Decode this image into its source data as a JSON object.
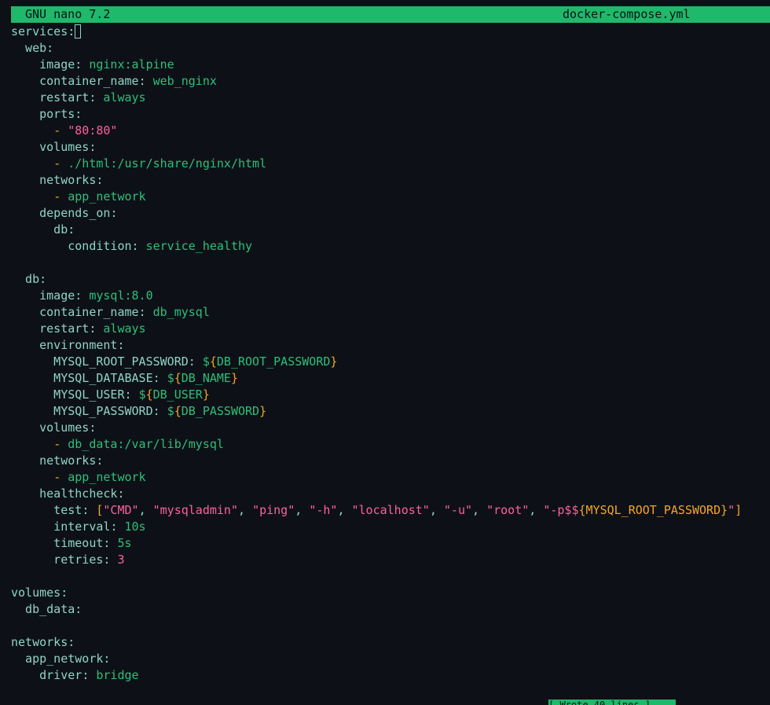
{
  "titlebar": {
    "app_name": "GNU nano 7.2",
    "file_name": "docker-compose.yml"
  },
  "statusbar": {
    "text": "[ Wrote 40 lines ]"
  },
  "colors": {
    "title_bg": "#20b86a",
    "background": "#0d1117",
    "key": "#8fd5c4",
    "value": "#2fbf7a",
    "dash": "#f5a623",
    "string": "#ff5fa2"
  },
  "lines": [
    [
      {
        "t": "k",
        "v": "services"
      },
      {
        "t": "p",
        "v": ":"
      },
      {
        "t": "cursor",
        "v": ""
      }
    ],
    [
      {
        "t": "k",
        "v": "  web"
      },
      {
        "t": "p",
        "v": ":"
      }
    ],
    [
      {
        "t": "k",
        "v": "    image"
      },
      {
        "t": "p",
        "v": ": "
      },
      {
        "t": "v",
        "v": "nginx:alpine"
      }
    ],
    [
      {
        "t": "k",
        "v": "    container_name"
      },
      {
        "t": "p",
        "v": ": "
      },
      {
        "t": "v",
        "v": "web_nginx"
      }
    ],
    [
      {
        "t": "k",
        "v": "    restart"
      },
      {
        "t": "p",
        "v": ": "
      },
      {
        "t": "v",
        "v": "always"
      }
    ],
    [
      {
        "t": "k",
        "v": "    ports"
      },
      {
        "t": "p",
        "v": ":"
      }
    ],
    [
      {
        "t": "k",
        "v": "      "
      },
      {
        "t": "d",
        "v": "- "
      },
      {
        "t": "s",
        "v": "\"80:80\""
      }
    ],
    [
      {
        "t": "k",
        "v": "    volumes"
      },
      {
        "t": "p",
        "v": ":"
      }
    ],
    [
      {
        "t": "k",
        "v": "      "
      },
      {
        "t": "d",
        "v": "- "
      },
      {
        "t": "v",
        "v": "./html:/usr/share/nginx/html"
      }
    ],
    [
      {
        "t": "k",
        "v": "    networks"
      },
      {
        "t": "p",
        "v": ":"
      }
    ],
    [
      {
        "t": "k",
        "v": "      "
      },
      {
        "t": "d",
        "v": "- "
      },
      {
        "t": "v",
        "v": "app_network"
      }
    ],
    [
      {
        "t": "k",
        "v": "    depends_on"
      },
      {
        "t": "p",
        "v": ":"
      }
    ],
    [
      {
        "t": "k",
        "v": "      db"
      },
      {
        "t": "p",
        "v": ":"
      }
    ],
    [
      {
        "t": "k",
        "v": "        condition"
      },
      {
        "t": "p",
        "v": ": "
      },
      {
        "t": "v",
        "v": "service_healthy"
      }
    ],
    [],
    [
      {
        "t": "k",
        "v": "  db"
      },
      {
        "t": "p",
        "v": ":"
      }
    ],
    [
      {
        "t": "k",
        "v": "    image"
      },
      {
        "t": "p",
        "v": ": "
      },
      {
        "t": "v",
        "v": "mysql:8.0"
      }
    ],
    [
      {
        "t": "k",
        "v": "    container_name"
      },
      {
        "t": "p",
        "v": ": "
      },
      {
        "t": "v",
        "v": "db_mysql"
      }
    ],
    [
      {
        "t": "k",
        "v": "    restart"
      },
      {
        "t": "p",
        "v": ": "
      },
      {
        "t": "v",
        "v": "always"
      }
    ],
    [
      {
        "t": "k",
        "v": "    environment"
      },
      {
        "t": "p",
        "v": ":"
      }
    ],
    [
      {
        "t": "k",
        "v": "      MYSQL_ROOT_PASSWORD"
      },
      {
        "t": "p",
        "v": ": "
      },
      {
        "t": "v",
        "v": "$"
      },
      {
        "t": "b",
        "v": "{"
      },
      {
        "t": "v",
        "v": "DB_ROOT_PASSWORD"
      },
      {
        "t": "b",
        "v": "}"
      }
    ],
    [
      {
        "t": "k",
        "v": "      MYSQL_DATABASE"
      },
      {
        "t": "p",
        "v": ": "
      },
      {
        "t": "v",
        "v": "$"
      },
      {
        "t": "b",
        "v": "{"
      },
      {
        "t": "v",
        "v": "DB_NAME"
      },
      {
        "t": "b",
        "v": "}"
      }
    ],
    [
      {
        "t": "k",
        "v": "      MYSQL_USER"
      },
      {
        "t": "p",
        "v": ": "
      },
      {
        "t": "v",
        "v": "$"
      },
      {
        "t": "b",
        "v": "{"
      },
      {
        "t": "v",
        "v": "DB_USER"
      },
      {
        "t": "b",
        "v": "}"
      }
    ],
    [
      {
        "t": "k",
        "v": "      MYSQL_PASSWORD"
      },
      {
        "t": "p",
        "v": ": "
      },
      {
        "t": "v",
        "v": "$"
      },
      {
        "t": "b",
        "v": "{"
      },
      {
        "t": "v",
        "v": "DB_PASSWORD"
      },
      {
        "t": "b",
        "v": "}"
      }
    ],
    [
      {
        "t": "k",
        "v": "    volumes"
      },
      {
        "t": "p",
        "v": ":"
      }
    ],
    [
      {
        "t": "k",
        "v": "      "
      },
      {
        "t": "d",
        "v": "- "
      },
      {
        "t": "v",
        "v": "db_data:/var/lib/mysql"
      }
    ],
    [
      {
        "t": "k",
        "v": "    networks"
      },
      {
        "t": "p",
        "v": ":"
      }
    ],
    [
      {
        "t": "k",
        "v": "      "
      },
      {
        "t": "d",
        "v": "- "
      },
      {
        "t": "v",
        "v": "app_network"
      }
    ],
    [
      {
        "t": "k",
        "v": "    healthcheck"
      },
      {
        "t": "p",
        "v": ":"
      }
    ],
    [
      {
        "t": "k",
        "v": "      test"
      },
      {
        "t": "p",
        "v": ": "
      },
      {
        "t": "b",
        "v": "["
      },
      {
        "t": "s",
        "v": "\"CMD\""
      },
      {
        "t": "p",
        "v": ", "
      },
      {
        "t": "s",
        "v": "\"mysqladmin\""
      },
      {
        "t": "p",
        "v": ", "
      },
      {
        "t": "s",
        "v": "\"ping\""
      },
      {
        "t": "p",
        "v": ", "
      },
      {
        "t": "s",
        "v": "\"-h\""
      },
      {
        "t": "p",
        "v": ", "
      },
      {
        "t": "s",
        "v": "\"localhost\""
      },
      {
        "t": "p",
        "v": ", "
      },
      {
        "t": "s",
        "v": "\"-u\""
      },
      {
        "t": "p",
        "v": ", "
      },
      {
        "t": "s",
        "v": "\"root\""
      },
      {
        "t": "p",
        "v": ", "
      },
      {
        "t": "s",
        "v": "\"-p$$"
      },
      {
        "t": "b",
        "v": "{"
      },
      {
        "t": "d",
        "v": "MYSQL_ROOT_PASSWORD"
      },
      {
        "t": "b",
        "v": "}"
      },
      {
        "t": "s",
        "v": "\""
      },
      {
        "t": "b",
        "v": "]"
      }
    ],
    [
      {
        "t": "k",
        "v": "      interval"
      },
      {
        "t": "p",
        "v": ": "
      },
      {
        "t": "v",
        "v": "10s"
      }
    ],
    [
      {
        "t": "k",
        "v": "      timeout"
      },
      {
        "t": "p",
        "v": ": "
      },
      {
        "t": "v",
        "v": "5s"
      }
    ],
    [
      {
        "t": "k",
        "v": "      retries"
      },
      {
        "t": "p",
        "v": ": "
      },
      {
        "t": "n",
        "v": "3"
      }
    ],
    [],
    [
      {
        "t": "k",
        "v": "volumes"
      },
      {
        "t": "p",
        "v": ":"
      }
    ],
    [
      {
        "t": "k",
        "v": "  db_data"
      },
      {
        "t": "p",
        "v": ":"
      }
    ],
    [],
    [
      {
        "t": "k",
        "v": "networks"
      },
      {
        "t": "p",
        "v": ":"
      }
    ],
    [
      {
        "t": "k",
        "v": "  app_network"
      },
      {
        "t": "p",
        "v": ":"
      }
    ],
    [
      {
        "t": "k",
        "v": "    driver"
      },
      {
        "t": "p",
        "v": ": "
      },
      {
        "t": "v",
        "v": "bridge"
      }
    ]
  ]
}
